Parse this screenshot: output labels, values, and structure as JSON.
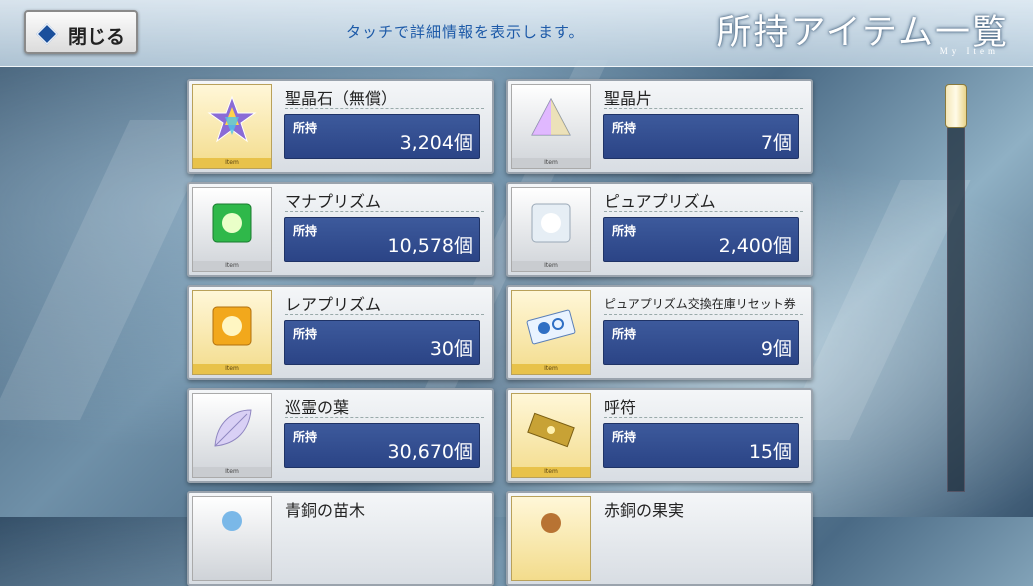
{
  "header": {
    "close_label": "閉じる",
    "hint": "タッチで詳細情報を表示します。",
    "title": "所持アイテム一覧",
    "subtitle": "My Item"
  },
  "own_label": "所持",
  "icon_tag": "Item",
  "items": [
    {
      "name": "聖晶石（無償）",
      "count": "3,204個",
      "icon": "saint-quartz-icon"
    },
    {
      "name": "聖晶片",
      "count": "7個",
      "icon": "quartz-fragment-icon"
    },
    {
      "name": "マナプリズム",
      "count": "10,578個",
      "icon": "mana-prism-icon"
    },
    {
      "name": "ピュアプリズム",
      "count": "2,400個",
      "icon": "pure-prism-icon"
    },
    {
      "name": "レアプリズム",
      "count": "30個",
      "icon": "rare-prism-icon"
    },
    {
      "name": "ピュアプリズム交換在庫リセット券",
      "count": "9個",
      "icon": "reset-ticket-icon"
    },
    {
      "name": "巡霊の葉",
      "count": "30,670個",
      "icon": "spirit-leaf-icon"
    },
    {
      "name": "呼符",
      "count": "15個",
      "icon": "summon-ticket-icon"
    },
    {
      "name": "青銅の苗木",
      "count": "",
      "icon": "bronze-sapling-icon"
    },
    {
      "name": "赤銅の果実",
      "count": "",
      "icon": "copper-fruit-icon"
    }
  ]
}
